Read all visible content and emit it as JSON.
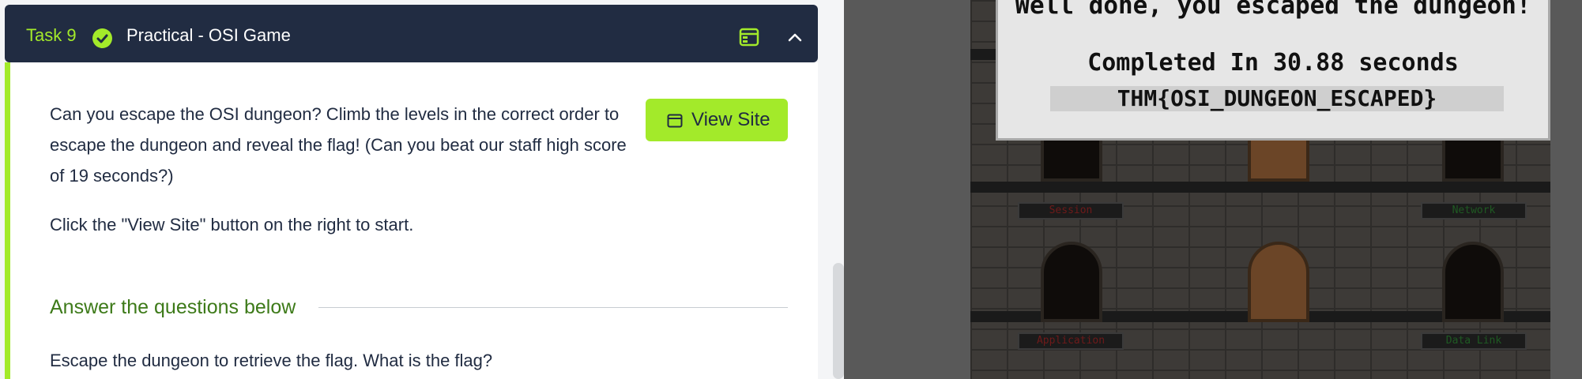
{
  "task": {
    "number_label": "Task 9",
    "title": "Practical - OSI Game",
    "paragraph1": "Can you escape the OSI dungeon? Climb the levels in the correct order to escape the dungeon and reveal the flag! (Can you beat our staff high score of 19 seconds?)",
    "paragraph2": "Click the \"View Site\" button on the right to start.",
    "view_site_label": "View Site",
    "answers_heading": "Answer the questions below",
    "question": "Escape the dungeon to retrieve the flag. What is the flag?"
  },
  "game": {
    "message_line1": "Well done, you escaped the dungeon!",
    "message_line2": "Completed In 30.88 seconds",
    "flag": "THM{OSI_DUNGEON_ESCAPED}",
    "layers": {
      "session": "Session",
      "network": "Network",
      "application": "Application",
      "data_link": "Data Link"
    }
  },
  "colors": {
    "accent": "#a3ea2a",
    "header_bg": "#212c42",
    "heading_green": "#3d7a19"
  }
}
